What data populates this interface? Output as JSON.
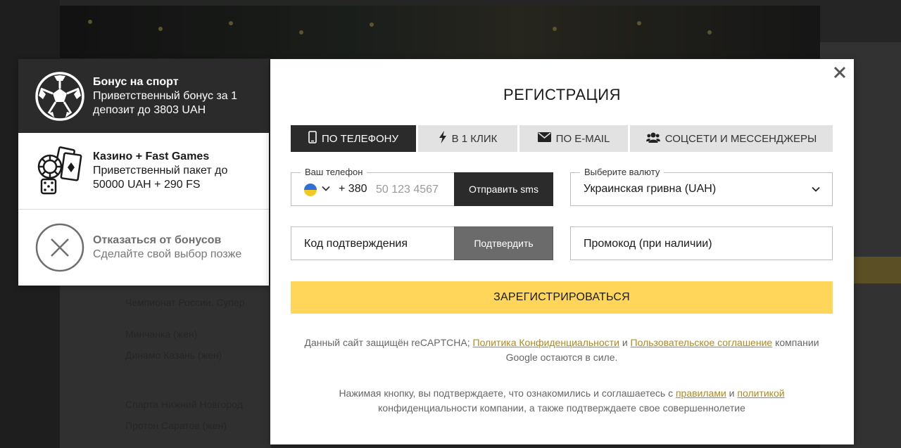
{
  "bonuses": {
    "sport": {
      "title": "Бонус на спорт",
      "line1": "Приветственный бонус за 1",
      "line2": "депозит до 3803 UAH",
      "icon": "soccer-ball-icon"
    },
    "casino": {
      "title": "Казино + Fast Games",
      "line1": "Приветственный пакет до",
      "line2": "50000 UAH + 290 FS",
      "icon": "casino-chips-cards-dice-icon"
    },
    "decline": {
      "title": "Отказаться от бонусов",
      "line1": "Сделайте свой выбор позже",
      "icon": "cross-circle-icon"
    }
  },
  "background_rows": [
    "Чемпионат России. Супер",
    "Минчанка (жен)",
    "Динамо Казань (жен)",
    "Спарта Нижний Новгород",
    "Протон Саратов (жен)"
  ],
  "modal": {
    "title": "РЕГИСТРАЦИЯ",
    "tabs": [
      {
        "label": "ПО ТЕЛЕФОНУ",
        "icon": "phone-icon",
        "active": true
      },
      {
        "label": "В 1 КЛИК",
        "icon": "lightning-icon",
        "active": false
      },
      {
        "label": "ПО E-MAIL",
        "icon": "envelope-icon",
        "active": false
      },
      {
        "label": "СОЦСЕТИ И МЕССЕНДЖЕРЫ",
        "icon": "users-icon",
        "active": false
      }
    ],
    "phone": {
      "label": "Ваш телефон",
      "country_code": "+ 380",
      "placeholder": "50 123 4567",
      "send_sms": "Отправить sms"
    },
    "currency": {
      "label": "Выберите валюту",
      "value": "Украинская гривна (UAH)"
    },
    "code": {
      "placeholder": "Код подтверждения",
      "confirm": "Подтвердить"
    },
    "promo": {
      "placeholder": "Промокод (при наличии)"
    },
    "register": "ЗАРЕГИСТРИРОВАТЬСЯ",
    "captcha_note": {
      "prefix": "Данный сайт защищён reCAPTCHA;",
      "privacy_link": "Политика Конфиденциальности",
      "and": "и",
      "terms_link": "Пользовательское соглашение",
      "suffix": "компании Google остаются в силе."
    },
    "consent_note": {
      "prefix": "Нажимая кнопку, вы подтверждаете, что ознакомились и соглашаетесь с",
      "rules_link": "правилами",
      "and": "и",
      "policy_link": "политикой",
      "suffix": "конфиденциальности компании, а также подтверждаете свое совершеннолетие"
    }
  },
  "colors": {
    "accent_yellow": "#ffd55a",
    "dark": "#2b2b2b",
    "link": "#b08a1a",
    "flag_blue": "#2f6fd8",
    "flag_yellow": "#f2c91f"
  }
}
